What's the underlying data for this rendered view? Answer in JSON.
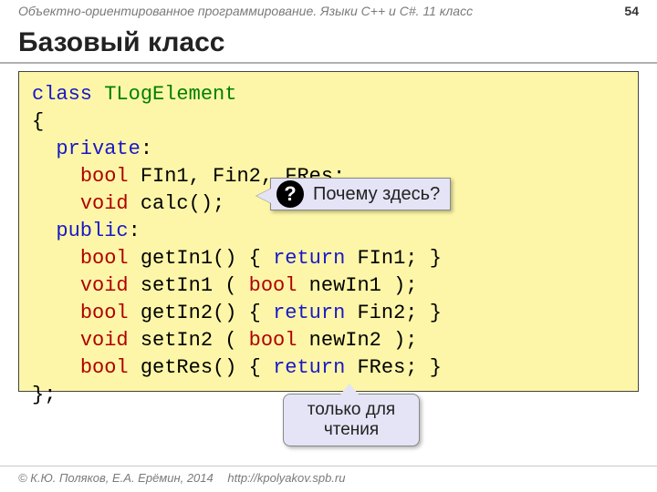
{
  "header": {
    "course": "Объектно-ориентированное программирование. Языки C++ и C#. 11 класс",
    "page": "54"
  },
  "title": "Базовый класс",
  "code": {
    "class_kw": "class",
    "class_name": " TLogElement",
    "brace_open": "{",
    "private_kw": "private",
    "colon": ":",
    "indent2": "    ",
    "indent1": "  ",
    "bool_kw": "bool",
    "void_kw": "void",
    "return_kw": "return",
    "fields": " FIn1, Fin2, FRes;",
    "calc": " calc();",
    "public_kw": "public",
    "getIn1a": " getIn1() { ",
    "getIn1b": " FIn1; }",
    "setIn1a": " setIn1 ( ",
    "setIn1b": " newIn1 );",
    "getIn2a": " getIn2() { ",
    "getIn2b": " Fin2; }",
    "setIn2a": " setIn2 ( ",
    "setIn2b": " newIn2 );",
    "getResa": " getRes() { ",
    "getResb": " FRes; }",
    "brace_close": "};"
  },
  "callouts": {
    "why_here": "Почему здесь?",
    "qmark": "?",
    "readonly_l1": "только для",
    "readonly_l2": "чтения"
  },
  "footer": {
    "authors": "© К.Ю. Поляков, Е.А. Ерёмин, 2014",
    "url": "http://kpolyakov.spb.ru"
  }
}
